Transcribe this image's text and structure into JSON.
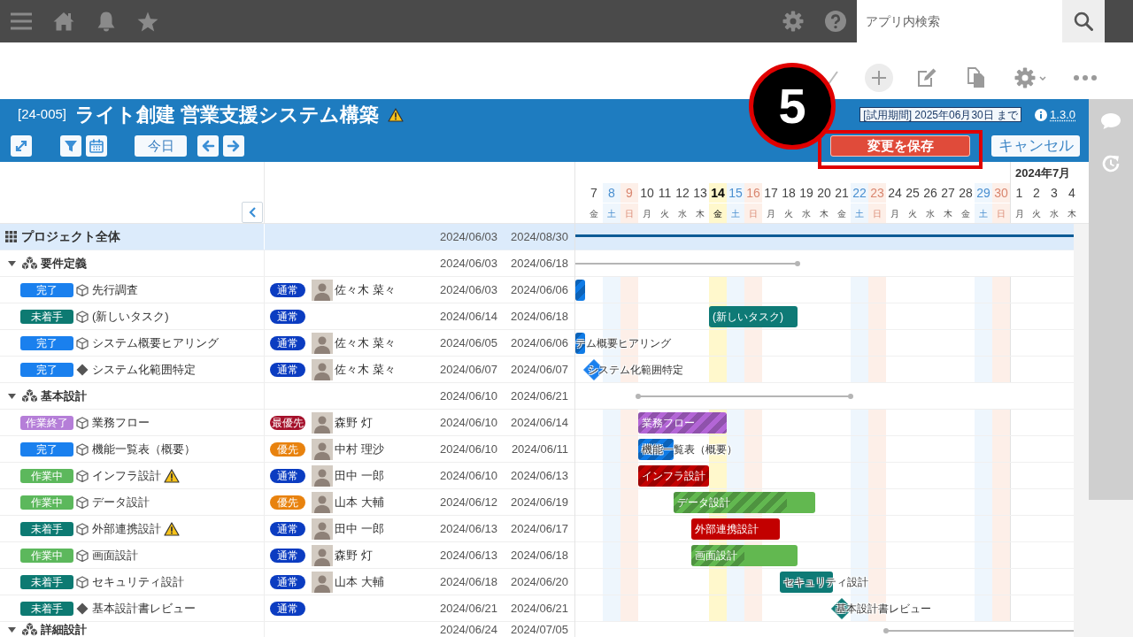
{
  "top_bar": {
    "search": {
      "placeholder": "アプリ内検索"
    }
  },
  "header": {
    "code": "[24-005]",
    "title": "ライト創建 営業支援システム構築",
    "warning": true,
    "trial_notice": "[試用期間] 2025年06月30日 まで",
    "version": "1.3.0"
  },
  "controls": {
    "today": "今日",
    "save": "変更を保存",
    "cancel": "キャンセル"
  },
  "annotation": {
    "step": "5"
  },
  "timeline": {
    "days": [
      {
        "day": "7",
        "weekday": "金",
        "kind": "weekday",
        "today": false
      },
      {
        "day": "8",
        "weekday": "土",
        "kind": "saturday",
        "today": false
      },
      {
        "day": "9",
        "weekday": "日",
        "kind": "sunday",
        "today": false
      },
      {
        "day": "10",
        "weekday": "月",
        "kind": "weekday",
        "today": false
      },
      {
        "day": "11",
        "weekday": "火",
        "kind": "weekday",
        "today": false
      },
      {
        "day": "12",
        "weekday": "水",
        "kind": "weekday",
        "today": false
      },
      {
        "day": "13",
        "weekday": "木",
        "kind": "weekday",
        "today": false
      },
      {
        "day": "14",
        "weekday": "金",
        "kind": "weekday",
        "today": true
      },
      {
        "day": "15",
        "weekday": "土",
        "kind": "saturday",
        "today": false
      },
      {
        "day": "16",
        "weekday": "日",
        "kind": "sunday",
        "today": false
      },
      {
        "day": "17",
        "weekday": "月",
        "kind": "weekday",
        "today": false
      },
      {
        "day": "18",
        "weekday": "火",
        "kind": "weekday",
        "today": false
      },
      {
        "day": "19",
        "weekday": "水",
        "kind": "weekday",
        "today": false
      },
      {
        "day": "20",
        "weekday": "木",
        "kind": "weekday",
        "today": false
      },
      {
        "day": "21",
        "weekday": "金",
        "kind": "weekday",
        "today": false
      },
      {
        "day": "22",
        "weekday": "土",
        "kind": "saturday",
        "today": false
      },
      {
        "day": "23",
        "weekday": "日",
        "kind": "sunday",
        "today": false
      },
      {
        "day": "24",
        "weekday": "月",
        "kind": "weekday",
        "today": false
      },
      {
        "day": "25",
        "weekday": "火",
        "kind": "weekday",
        "today": false
      },
      {
        "day": "26",
        "weekday": "水",
        "kind": "weekday",
        "today": false
      },
      {
        "day": "27",
        "weekday": "木",
        "kind": "weekday",
        "today": false
      },
      {
        "day": "28",
        "weekday": "金",
        "kind": "weekday",
        "today": false
      },
      {
        "day": "29",
        "weekday": "土",
        "kind": "saturday",
        "today": false
      },
      {
        "day": "30",
        "weekday": "日",
        "kind": "sunday",
        "today": false
      },
      {
        "day": "1",
        "weekday": "月",
        "kind": "weekday",
        "today": false,
        "month_label": "2024年7月"
      },
      {
        "day": "2",
        "weekday": "火",
        "kind": "weekday",
        "today": false
      },
      {
        "day": "3",
        "weekday": "水",
        "kind": "weekday",
        "today": false
      },
      {
        "day": "4",
        "weekday": "木",
        "kind": "weekday",
        "today": false
      }
    ]
  },
  "rows": [
    {
      "kind": "project",
      "name": "プロジェクト全体",
      "start": "2024/06/03",
      "end": "2024/08/30"
    },
    {
      "kind": "group",
      "name": "要件定義",
      "expanded": true,
      "start": "2024/06/03",
      "end": "2024/06/18"
    },
    {
      "kind": "task",
      "status": {
        "label": "完了",
        "color": "#1a80ee"
      },
      "name": "先行調査",
      "warning": false,
      "priority": {
        "label": "通常",
        "color": "#0b3cc1"
      },
      "assignee": "佐々木 菜々",
      "start": "2024/06/03",
      "end": "2024/06/06",
      "bar": {
        "color": "#0f7be6",
        "level": 1
      }
    },
    {
      "kind": "task",
      "status": {
        "label": "未着手",
        "color": "#0d7a72"
      },
      "name": "(新しいタスク)",
      "warning": false,
      "priority": {
        "label": "通常",
        "color": "#0b3cc1"
      },
      "start": "2024/06/14",
      "end": "2024/06/18",
      "bar": {
        "color": "#0e7a76",
        "label": "(新しいタスク)"
      }
    },
    {
      "kind": "task",
      "status": {
        "label": "完了",
        "color": "#1a80ee"
      },
      "name": "システム概要ヒアリング",
      "warning": false,
      "priority": {
        "label": "通常",
        "color": "#0b3cc1"
      },
      "assignee": "佐々木 菜々",
      "start": "2024/06/05",
      "end": "2024/06/06",
      "bar": {
        "color": "#0f7be6",
        "level": 1,
        "label": "テム概要ヒアリング"
      }
    },
    {
      "kind": "milestone",
      "status": {
        "label": "完了",
        "color": "#1a80ee"
      },
      "name": "システム化範囲特定",
      "warning": false,
      "priority": {
        "label": "通常",
        "color": "#0b3cc1"
      },
      "assignee": "佐々木 菜々",
      "start": "2024/06/07",
      "end": "2024/06/07",
      "marker": {
        "color": "#1a80ee",
        "label": "システム化範囲特定"
      }
    },
    {
      "kind": "group",
      "name": "基本設計",
      "expanded": true,
      "start": "2024/06/10",
      "end": "2024/06/21"
    },
    {
      "kind": "task",
      "status": {
        "label": "作業終了",
        "color": "#b57ed8"
      },
      "name": "業務フロー",
      "warning": false,
      "priority": {
        "label": "最優先",
        "color": "#a5112b"
      },
      "assignee": "森野 灯",
      "start": "2024/06/10",
      "end": "2024/06/14",
      "bar": {
        "color": "#b366d6",
        "level": 1,
        "label": "業務フロー"
      }
    },
    {
      "kind": "task",
      "status": {
        "label": "完了",
        "color": "#1a80ee"
      },
      "name": "機能一覧表（概要）",
      "warning": false,
      "priority": {
        "label": "優先",
        "color": "#e8820e"
      },
      "assignee": "中村 理沙",
      "start": "2024/06/10",
      "end": "2024/06/11",
      "bar": {
        "color": "#0f7be6",
        "level": 1,
        "label": "機能一覧表（概要）"
      }
    },
    {
      "kind": "task",
      "status": {
        "label": "作業中",
        "color": "#5cb85c"
      },
      "name": "インフラ設計",
      "warning": true,
      "priority": {
        "label": "通常",
        "color": "#0b3cc1"
      },
      "assignee": "田中 一郎",
      "start": "2024/06/10",
      "end": "2024/06/13",
      "bar": {
        "color": "#c20000",
        "level": 1,
        "label": "インフラ設計"
      }
    },
    {
      "kind": "task",
      "status": {
        "label": "作業中",
        "color": "#5cb85c"
      },
      "name": "データ設計",
      "warning": false,
      "priority": {
        "label": "優先",
        "color": "#e8820e"
      },
      "assignee": "山本 大輔",
      "start": "2024/06/12",
      "end": "2024/06/19",
      "bar": {
        "color": "#62b850",
        "level": 0.8,
        "label": "データ設計"
      }
    },
    {
      "kind": "task",
      "status": {
        "label": "未着手",
        "color": "#0d7a72"
      },
      "name": "外部連携設計",
      "warning": true,
      "priority": {
        "label": "通常",
        "color": "#0b3cc1"
      },
      "assignee": "田中 一郎",
      "start": "2024/06/13",
      "end": "2024/06/17",
      "bar": {
        "color": "#c20000",
        "label": "外部連携設計"
      }
    },
    {
      "kind": "task",
      "status": {
        "label": "作業中",
        "color": "#5cb85c"
      },
      "name": "画面設計",
      "warning": false,
      "priority": {
        "label": "通常",
        "color": "#0b3cc1"
      },
      "assignee": "森野 灯",
      "start": "2024/06/13",
      "end": "2024/06/18",
      "bar": {
        "color": "#62b850",
        "level": 0.5,
        "label": "画面設計"
      }
    },
    {
      "kind": "task",
      "status": {
        "label": "未着手",
        "color": "#0d7a72"
      },
      "name": "セキュリティ設計",
      "warning": false,
      "priority": {
        "label": "通常",
        "color": "#0b3cc1"
      },
      "assignee": "山本 大輔",
      "start": "2024/06/18",
      "end": "2024/06/20",
      "bar": {
        "color": "#0e7a76",
        "label": "セキュリティ設計"
      }
    },
    {
      "kind": "milestone",
      "status": {
        "label": "未着手",
        "color": "#0d7a72"
      },
      "name": "基本設計書レビュー",
      "warning": false,
      "priority": {
        "label": "通常",
        "color": "#0b3cc1"
      },
      "start": "2024/06/21",
      "end": "2024/06/21",
      "marker": {
        "color": "#0e7a76",
        "label": "基本設計書レビュー"
      }
    },
    {
      "kind": "group",
      "name": "詳細設計",
      "expanded": true,
      "start": "2024/06/24",
      "end": "2024/07/05"
    }
  ]
}
